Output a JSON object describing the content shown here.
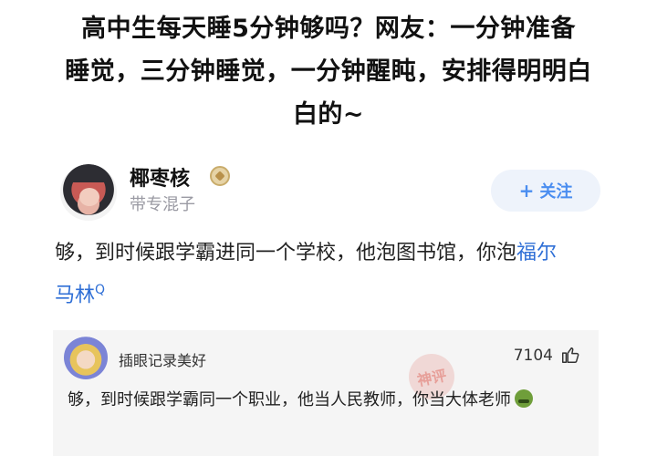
{
  "headline": {
    "line1": "高中生每天睡5分钟够吗？网友：一分钟准备",
    "line2": "睡觉，三分钟睡觉，一分钟醒盹，安排得明明白",
    "line3": "白的~"
  },
  "post": {
    "username": "椰枣核",
    "subtitle": "带专混子",
    "follow_label": "关注",
    "follow_prefix": "+"
  },
  "answer": {
    "text_before": "够，到时候跟学霸进同一个学校，他泡图书馆，你泡",
    "link_text": "福尔马林",
    "search_mark": "Q"
  },
  "comment": {
    "username": "插眼记录美好",
    "likes": "7104",
    "text": "够，到时候跟学霸同一个职业，他当人民教师，你当大体老师",
    "watermark": "神评"
  },
  "colors": {
    "link": "#2f6fd6",
    "follow": "#4a8df0",
    "follow_bg": "#eef3fb",
    "comment_bg": "#f5f5f5"
  }
}
